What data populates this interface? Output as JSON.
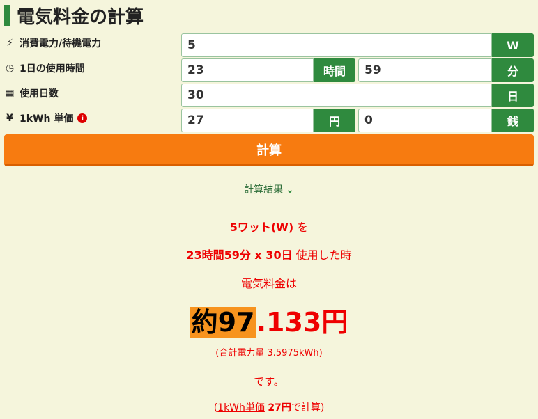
{
  "page": {
    "title": "電気料金の計算"
  },
  "form": {
    "power": {
      "label": "消費電力/待機電力",
      "value": "5",
      "unit": "W"
    },
    "hours": {
      "label": "1日の使用時間",
      "hours_value": "23",
      "hours_unit": "時間",
      "minutes_value": "59",
      "minutes_unit": "分"
    },
    "days": {
      "label": "使用日数",
      "value": "30",
      "unit": "日"
    },
    "price": {
      "label": "1kWh 単価",
      "yen_value": "27",
      "yen_unit": "円",
      "sen_value": "0",
      "sen_unit": "銭"
    },
    "calc_button": "計算"
  },
  "result": {
    "header": "計算結果",
    "power_text": "5ワット(W)",
    "wo": "を",
    "usage_text": "23時間59分 x 30日",
    "usage_suffix": "使用した時",
    "fee_intro": "電気料金は",
    "amount_prefix": "約97",
    "amount_suffix": ".133円",
    "total_energy": "(合計電力量 3.5975kWh)",
    "desu": "です。",
    "footer_open": "(",
    "footer_link": "1kWh単価",
    "footer_price": "27円",
    "footer_close": "で計算)"
  },
  "icons": {
    "power": "bolt-icon",
    "hours": "clock-icon",
    "days": "calendar-icon",
    "price": "yen-icon",
    "info": "info-icon",
    "chevron": "chevron-down-icon"
  },
  "colors": {
    "accent_green": "#2f8a3e",
    "button_orange": "#f77b10",
    "result_red": "#e00000",
    "highlight_orange": "#f7931e",
    "background": "#f5f5dc"
  }
}
